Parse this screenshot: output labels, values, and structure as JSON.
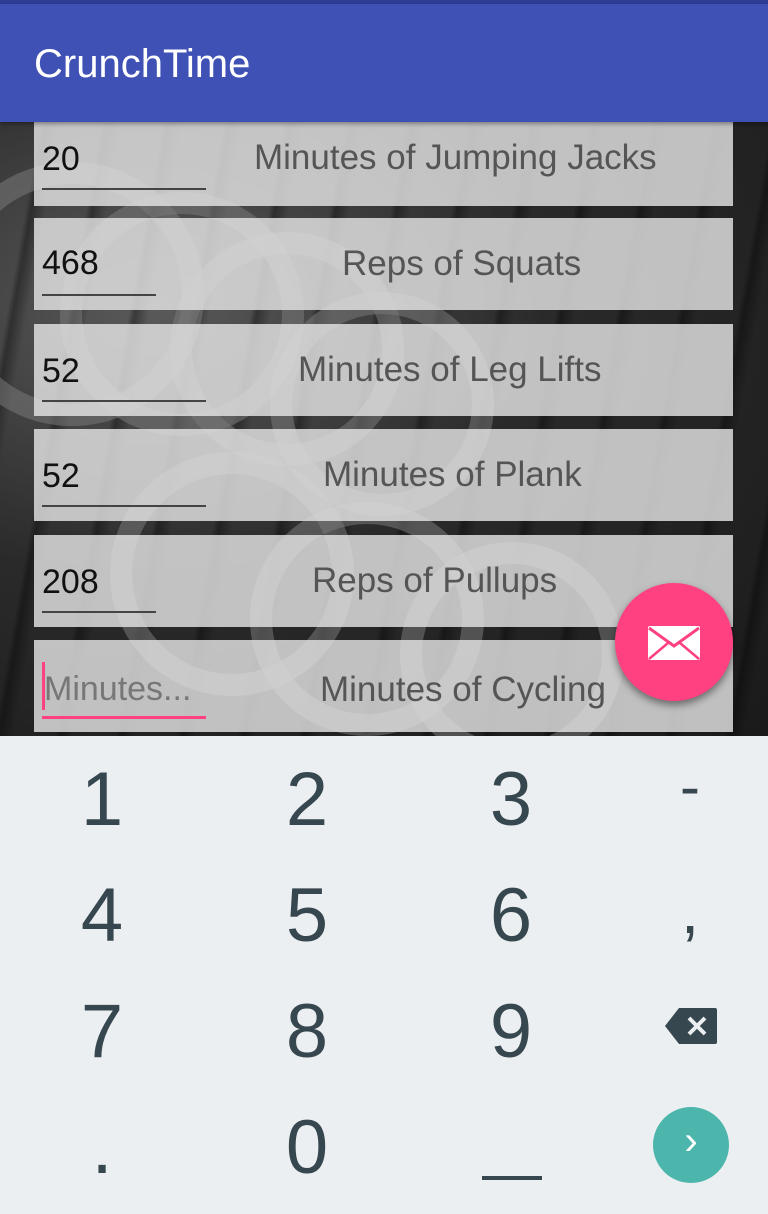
{
  "app": {
    "title": "CrunchTime"
  },
  "exercises": [
    {
      "value": "20",
      "label": "Minutes of Jumping Jacks"
    },
    {
      "value": "468",
      "label": "Reps of Squats"
    },
    {
      "value": "52",
      "label": "Minutes of Leg Lifts"
    },
    {
      "value": "52",
      "label": "Minutes of Plank"
    },
    {
      "value": "208",
      "label": "Reps of Pullups"
    },
    {
      "value": "",
      "placeholder": "Minutes...",
      "label": "Minutes of Cycling"
    }
  ],
  "fab": {
    "icon": "mail-icon",
    "color": "#ff4081"
  },
  "keyboard": {
    "row1": [
      "1",
      "2",
      "3",
      "-"
    ],
    "row2": [
      "4",
      "5",
      "6",
      ","
    ],
    "row3": [
      "7",
      "8",
      "9"
    ],
    "row4": [
      ".",
      "0"
    ],
    "backspace_icon": "backspace-icon",
    "go_icon": "chevron-right-icon",
    "space_icon": "space-icon"
  },
  "colors": {
    "appbar": "#3f51b5",
    "accent": "#ff4081",
    "go": "#4db6ac",
    "keyboard_bg": "#eceff1"
  }
}
